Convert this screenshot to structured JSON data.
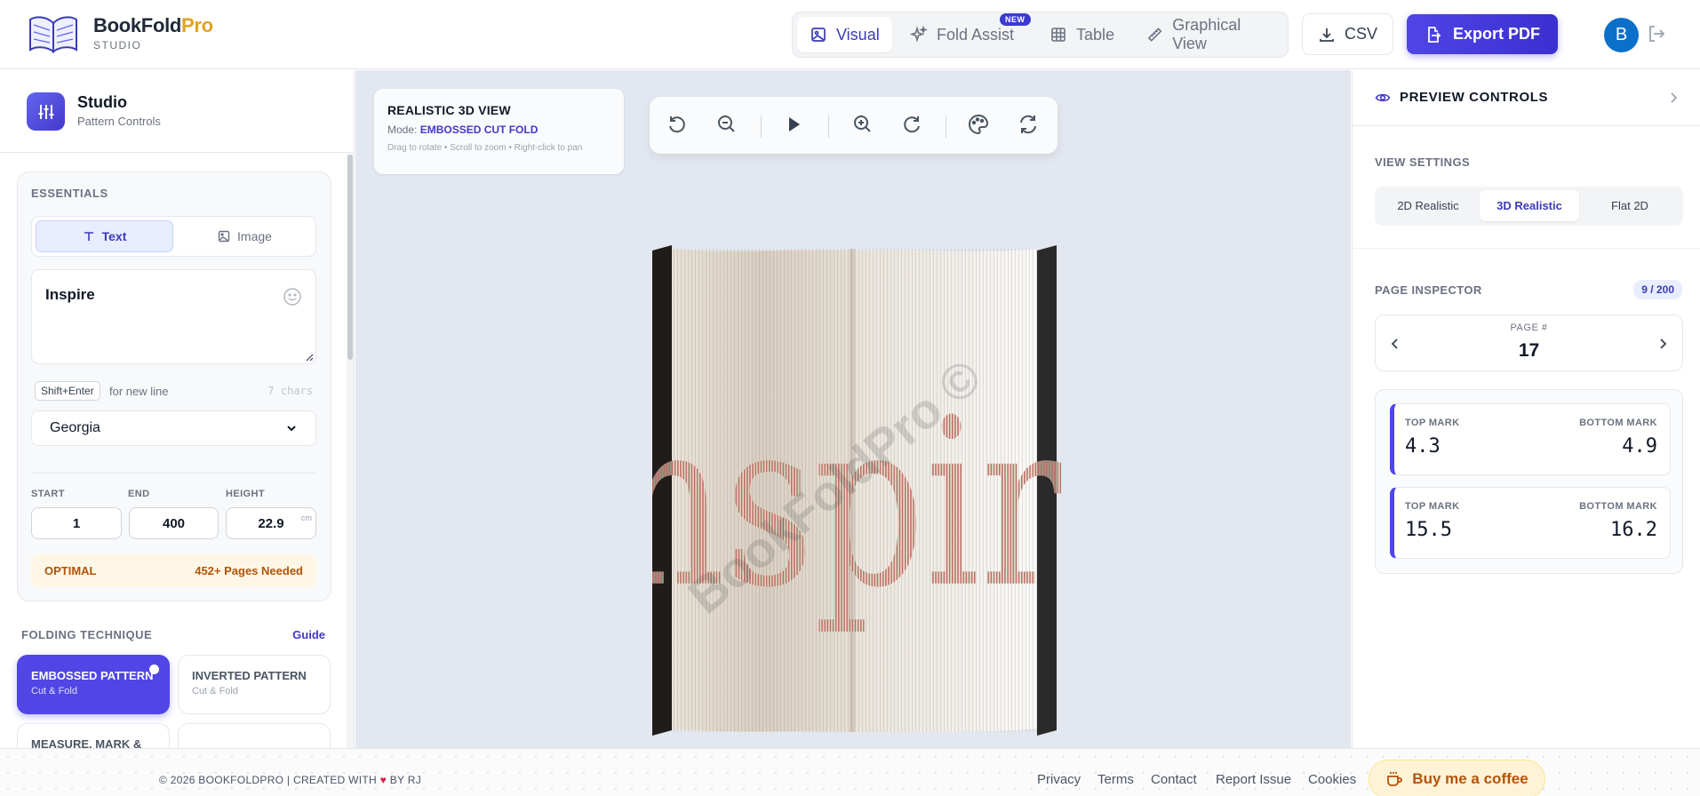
{
  "header": {
    "brand_name": "BookFold",
    "brand_pro": "Pro",
    "brand_sub": "STUDIO",
    "tabs": [
      {
        "label": "Visual",
        "icon": "image-icon",
        "active": true
      },
      {
        "label": "Fold Assist",
        "icon": "sparkles-icon",
        "badge": "NEW"
      },
      {
        "label": "Table",
        "icon": "table-icon"
      },
      {
        "label": "Graphical View",
        "icon": "ruler-icon"
      }
    ],
    "csv_label": "CSV",
    "export_label": "Export PDF",
    "avatar_initial": "B"
  },
  "sidebar": {
    "title": "Studio",
    "subtitle": "Pattern Controls",
    "essentials": {
      "label": "ESSENTIALS",
      "mode_text": "Text",
      "mode_image": "Image",
      "text_value": "Inspire",
      "shortcut": "Shift+Enter",
      "shortcut_hint": "for new line",
      "char_count": "7 chars",
      "font": "Georgia",
      "start_label": "START",
      "end_label": "END",
      "height_label": "HEIGHT",
      "start_value": "1",
      "end_value": "400",
      "height_value": "22.9",
      "height_unit": "cm",
      "status": "OPTIMAL",
      "pages_needed": "452+ Pages Needed"
    },
    "folding": {
      "label": "FOLDING TECHNIQUE",
      "guide": "Guide",
      "techniques": [
        {
          "title": "EMBOSSED PATTERN",
          "sub": "Cut & Fold",
          "active": true
        },
        {
          "title": "INVERTED PATTERN",
          "sub": "Cut & Fold"
        },
        {
          "title": "MEASURE, MARK &",
          "sub": ""
        }
      ]
    }
  },
  "canvas": {
    "info_title": "REALISTIC 3D VIEW",
    "mode_label": "Mode:",
    "mode_value": "EMBOSSED CUT FOLD",
    "hint": "Drag to rotate • Scroll to zoom • Right-click to pan",
    "book_word": "Inspire",
    "watermark": "BookFoldPro ©"
  },
  "right_panel": {
    "title": "PREVIEW CONTROLS",
    "view_settings_label": "VIEW SETTINGS",
    "view_options": [
      "2D Realistic",
      "3D Realistic",
      "Flat 2D"
    ],
    "active_view": "3D Realistic",
    "inspector_label": "PAGE INSPECTOR",
    "inspector_count": "9 / 200",
    "page_label": "PAGE #",
    "page_number": "17",
    "top_mark_label": "TOP MARK",
    "bottom_mark_label": "BOTTOM MARK",
    "marks": [
      {
        "top": "4.3",
        "bottom": "4.9"
      },
      {
        "top": "15.5",
        "bottom": "16.2"
      }
    ]
  },
  "footer": {
    "copyright_pre": "© 2026 BOOKFOLDPRO | CREATED WITH",
    "copyright_post": "BY RJ",
    "links": [
      "Privacy",
      "Terms",
      "Contact",
      "Report Issue",
      "Cookies"
    ],
    "coffee": "Buy me a coffee"
  },
  "colors": {
    "accent": "#4f46e5",
    "brand_pro": "#e0a21f",
    "canvas_bg": "#e3e7ef",
    "warning": "#b45309"
  }
}
